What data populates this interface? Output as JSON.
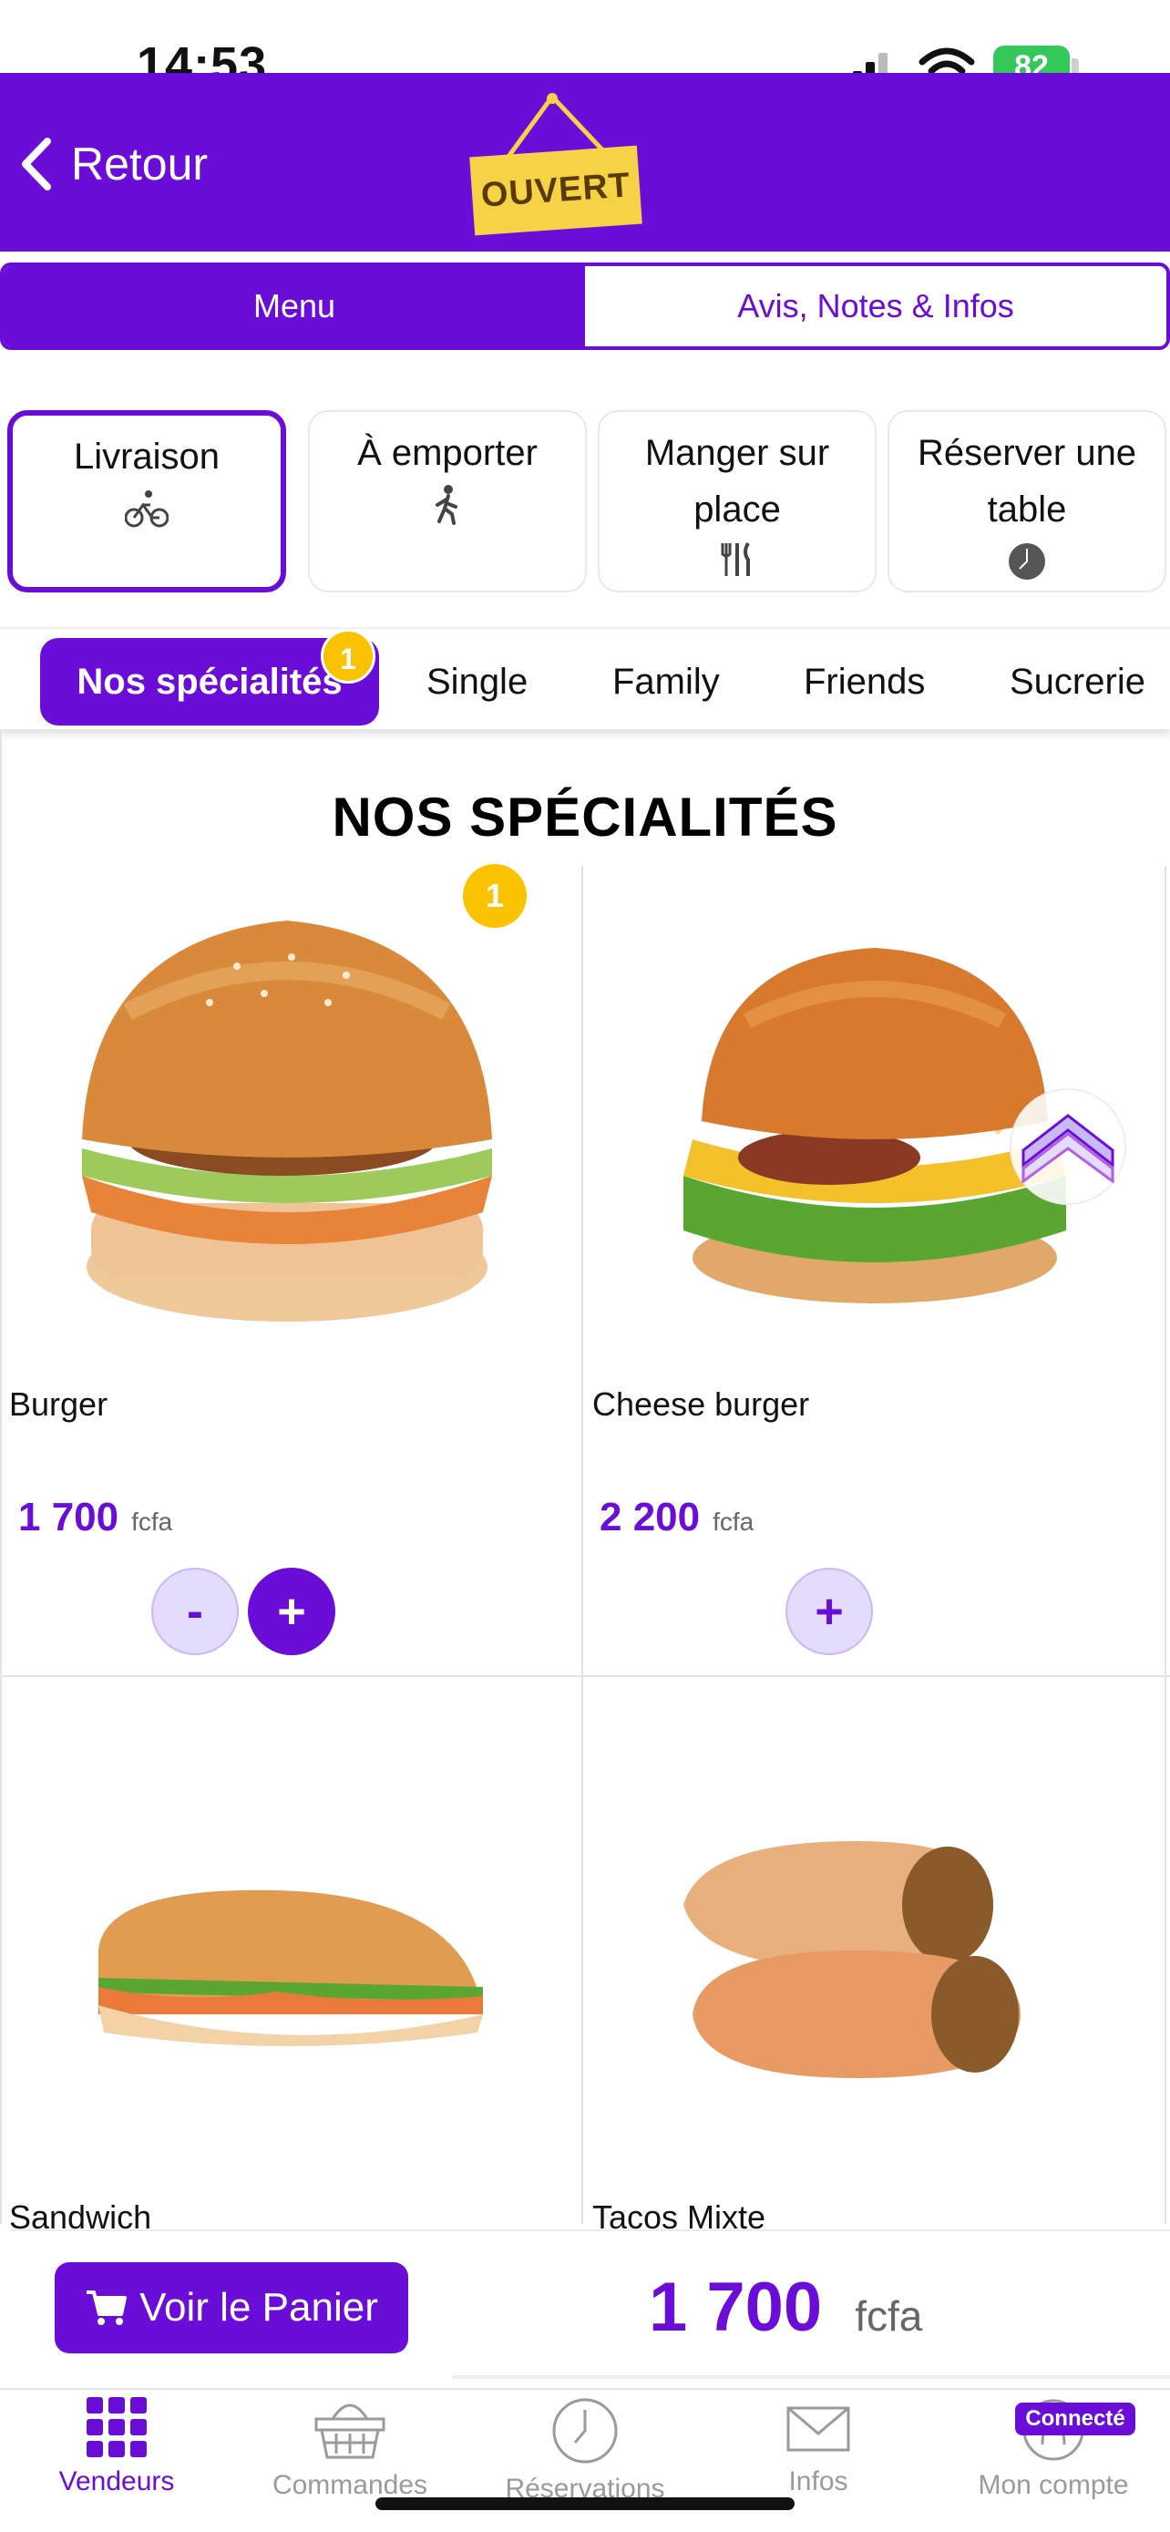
{
  "status_bar": {
    "time": "14:53",
    "battery": "82"
  },
  "header": {
    "back_label": "Retour",
    "sign_label": "OUVERT"
  },
  "tabs": [
    {
      "label": "Menu",
      "active": true
    },
    {
      "label": "Avis, Notes & Infos",
      "active": false
    }
  ],
  "service_modes": [
    {
      "line1": "Livraison",
      "line2": "",
      "icon": "bicycle-icon",
      "selected": true
    },
    {
      "line1": "À emporter",
      "line2": "",
      "icon": "walking-icon",
      "selected": false
    },
    {
      "line1": "Manger sur",
      "line2": "place",
      "icon": "cutlery-icon",
      "selected": false
    },
    {
      "line1": "Réserver une",
      "line2": "table",
      "icon": "clock-icon",
      "selected": false
    }
  ],
  "categories": {
    "items": [
      "Nos spécialités",
      "Single",
      "Family",
      "Friends",
      "Sucrerie"
    ],
    "active_badge": "1"
  },
  "section": {
    "title": "NOS SPÉCIALITÉS"
  },
  "products": [
    {
      "name": "Burger",
      "price": "1 700",
      "currency": "fcfa",
      "badge": "1",
      "minus": "-",
      "plus": "+"
    },
    {
      "name": "Cheese burger",
      "price": "2 200",
      "currency": "fcfa",
      "plus": "+"
    },
    {
      "name": "Sandwich"
    },
    {
      "name": "Tacos Mixte"
    }
  ],
  "cart": {
    "button_label": "Voir le Panier",
    "total": "1 700",
    "currency": "fcfa"
  },
  "bottom_nav": {
    "items": [
      {
        "label": "Vendeurs",
        "icon": "grid-icon",
        "active": true
      },
      {
        "label": "Commandes",
        "icon": "basket-icon",
        "active": false
      },
      {
        "label": "Réservations",
        "icon": "clock-icon",
        "active": false
      },
      {
        "label": "Infos",
        "icon": "mail-icon",
        "active": false
      },
      {
        "label": "Mon compte",
        "icon": "account-icon",
        "active": false
      }
    ],
    "connected_badge": "Connecté"
  },
  "colors": {
    "brand": "#6a0dd8",
    "badge": "#f9c300",
    "battery": "#34c759"
  }
}
